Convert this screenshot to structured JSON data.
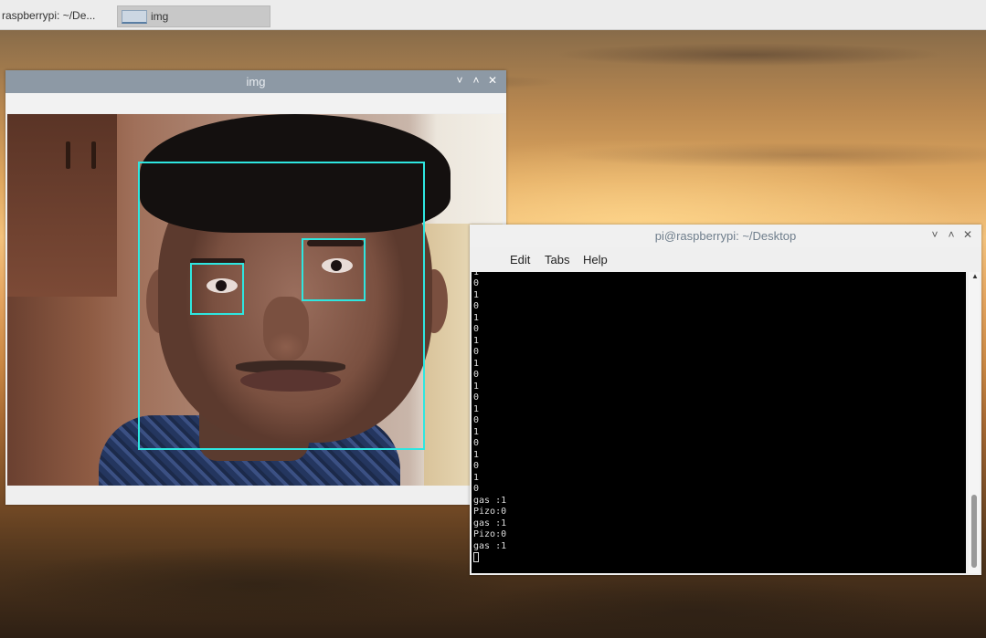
{
  "taskbar": {
    "terminal_task": "raspberrypi: ~/De...",
    "img_task": "img"
  },
  "img_window": {
    "title": "img",
    "controls": {
      "minimize": "˅",
      "maximize": "˄",
      "close": "✕"
    },
    "detections": {
      "face_color": "#2ee6e0"
    }
  },
  "terminal_window": {
    "title": "pi@raspberrypi: ~/Desktop",
    "controls": {
      "minimize": "˅",
      "maximize": "˄",
      "close": "✕"
    },
    "menu": {
      "edit": "Edit",
      "tabs": "Tabs",
      "help": "Help"
    },
    "partial_lines": [
      "1",
      "0",
      "1",
      "0",
      "1",
      "0",
      "1",
      "0",
      "1",
      "0",
      "1",
      "0",
      "1",
      "0",
      "1",
      "0",
      "1",
      "0",
      "1",
      "0"
    ],
    "last_line_0": "gas :1",
    "last_line_1": "Pizo:0",
    "last_line_2": "gas :1",
    "last_line_3": "Pizo:0",
    "last_line_4": "gas :1"
  }
}
